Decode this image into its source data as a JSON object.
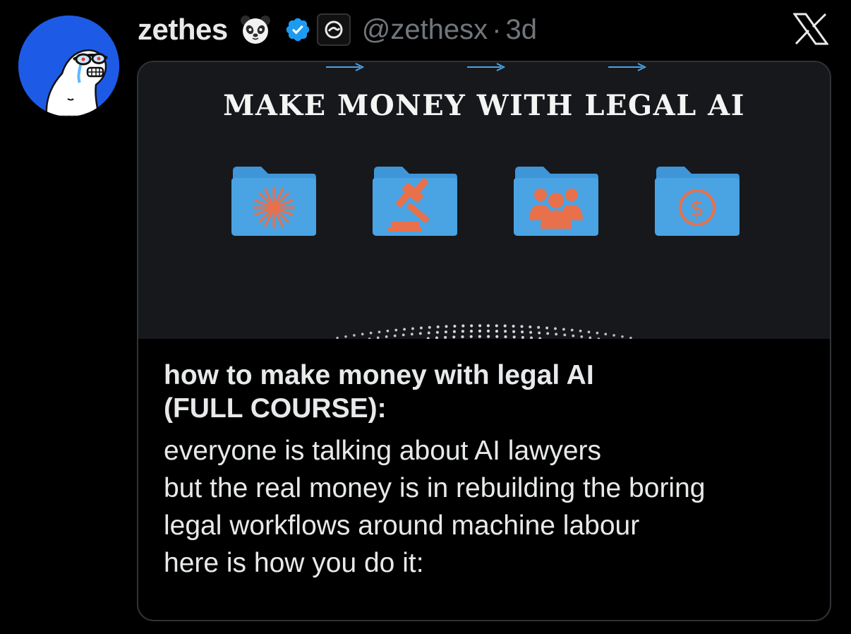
{
  "author": {
    "display_name": "zethes",
    "handle": "@zethesx",
    "separator": "·",
    "timestamp": "3d",
    "emoji": "panda-face",
    "verified": true,
    "affiliate_badge": "affiliate-badge-icon"
  },
  "platform": {
    "logo": "x-logo-icon"
  },
  "card": {
    "media": {
      "headline": "MAKE MONEY WITH LEGAL AI",
      "steps": [
        {
          "icon": "spark-icon"
        },
        {
          "icon": "gavel-icon"
        },
        {
          "icon": "people-icon"
        },
        {
          "icon": "dollar-icon"
        }
      ]
    },
    "title_line1": "how to make money with legal AI",
    "title_line2": "(FULL COURSE):",
    "body_lines": [
      "everyone is talking about AI lawyers",
      "but the real money is in rebuilding the boring",
      "legal workflows around machine labour",
      "here is how you do it:"
    ]
  },
  "colors": {
    "background": "#000000",
    "text_primary": "#e7e9ea",
    "text_secondary": "#71767b",
    "avatar_bg": "#1d5be6",
    "verified_blue": "#1d9bf0",
    "folder_blue": "#4aa3e2",
    "icon_orange": "#e8704b",
    "media_bg": "#17181c"
  }
}
